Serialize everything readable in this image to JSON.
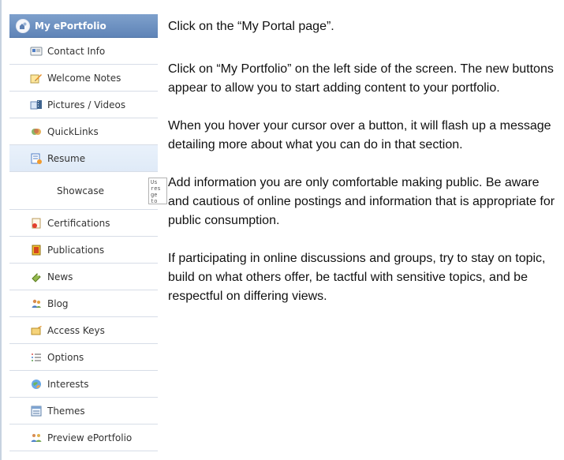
{
  "sidebar": {
    "header": {
      "title": "My ePortfolio",
      "icon": "portfolio-icon"
    },
    "items": [
      {
        "label": "Contact Info",
        "icon": "contact-card-icon",
        "active": false
      },
      {
        "label": "Welcome Notes",
        "icon": "note-pencil-icon",
        "active": false
      },
      {
        "label": "Pictures / Videos",
        "icon": "picture-video-icon",
        "active": false
      },
      {
        "label": "QuickLinks",
        "icon": "link-bubbles-icon",
        "active": false
      },
      {
        "label": "Resume",
        "icon": "resume-icon",
        "active": true
      },
      {
        "label": "Showcase",
        "icon": "",
        "active": false
      },
      {
        "label": "Certifications",
        "icon": "certificate-icon",
        "active": false
      },
      {
        "label": "Publications",
        "icon": "book-icon",
        "active": false
      },
      {
        "label": "News",
        "icon": "tag-icon",
        "active": false
      },
      {
        "label": "Blog",
        "icon": "people-icon",
        "active": false
      },
      {
        "label": "Access Keys",
        "icon": "key-folder-icon",
        "active": false
      },
      {
        "label": "Options",
        "icon": "options-list-icon",
        "active": false
      },
      {
        "label": "Interests",
        "icon": "globe-icon",
        "active": false
      },
      {
        "label": "Themes",
        "icon": "window-icon",
        "active": false
      },
      {
        "label": "Preview ePortfolio",
        "icon": "preview-people-icon",
        "active": false
      }
    ],
    "tooltip": [
      "Us",
      "res",
      "ge",
      "to"
    ]
  },
  "content": {
    "paragraphs": [
      "Click on the “My Portal page”.",
      "Click on “My Portfolio” on the left side of the screen. The new buttons appear to allow you to start adding content to your portfolio.",
      "When you hover your cursor over a button, it will flash up a message detailing more about what you can do in that section.",
      "Add information you are only comfortable making public. Be aware and cautious of online postings and information that is appropriate for public consumption.",
      "If participating in online discussions and groups, try to stay on topic, build on what others offer, be tactful with sensitive topics, and be respectful on differing views."
    ]
  },
  "colors": {
    "header_bg": "#6b8fc1",
    "active_bg": "#e6eff9",
    "divider": "#d7dde7",
    "sidebar_rule": "#c7d2e0"
  }
}
